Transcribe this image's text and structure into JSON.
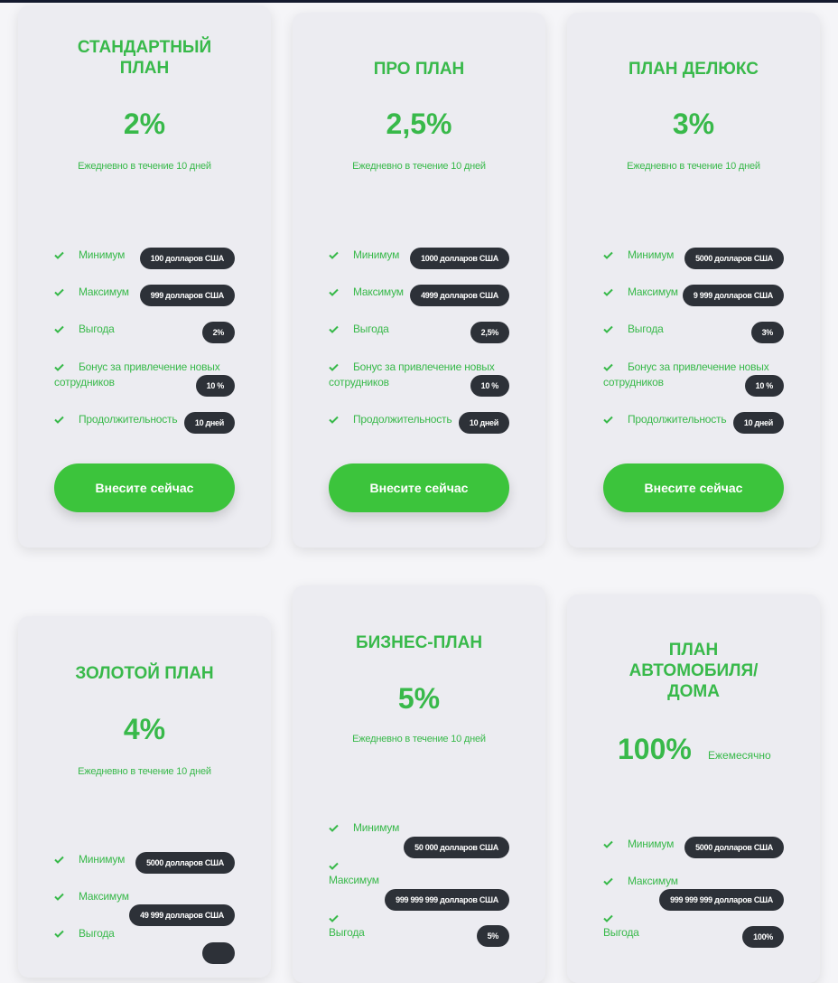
{
  "common": {
    "daily_note": "Ежедневно в течение 10 дней",
    "min_label": "Минимум",
    "max_label": "Максимум",
    "profit_label": "Выгода",
    "bonus_label": "Бонус за привлечение новых сотрудников",
    "bonus_line1": "Бонус за привлечение новых",
    "bonus_line2": "сотрудников",
    "duration_label": "Продолжительность",
    "deposit_button": "Внесите сейчас"
  },
  "plans": [
    {
      "title": "СТАНДАРТНЫЙ ПЛАН",
      "rate": "2%",
      "min": "100 долларов США",
      "max": "999 долларов США",
      "profit": "2%",
      "bonus": "10 %",
      "duration": "10 дней"
    },
    {
      "title": "ПРО ПЛАН",
      "rate": "2,5%",
      "min": "1000 долларов США",
      "max": "4999 долларов США",
      "profit": "2,5%",
      "bonus": "10 %",
      "duration": "10 дней"
    },
    {
      "title": "ПЛАН ДЕЛЮКС",
      "rate": "3%",
      "min": "5000 долларов США",
      "max": "9 999 долларов США",
      "profit": "3%",
      "bonus": "10 %",
      "duration": "10 дней"
    },
    {
      "title": "ЗОЛОТОЙ ПЛАН",
      "rate": "4%",
      "min": "5000 долларов США",
      "max": "49 999 долларов США"
    },
    {
      "title": "БИЗНЕС-ПЛАН",
      "rate": "5%",
      "min": "50 000 долларов США",
      "max": "999 999 999 долларов США",
      "profit": "5%"
    },
    {
      "title": "ПЛАН АВТОМОБИЛЯ/ ДОМА",
      "rate": "100%",
      "note": "Ежемесячно",
      "min": "5000 долларов США",
      "max": "999 999 999 долларов США",
      "profit": "100%"
    }
  ],
  "colors": {
    "accent": "#38b94a",
    "button": "#3cc43c",
    "pill": "#2d3138",
    "card": "#ececf1",
    "background": "#f5f5f8"
  },
  "icons": {
    "check": "check-icon"
  }
}
